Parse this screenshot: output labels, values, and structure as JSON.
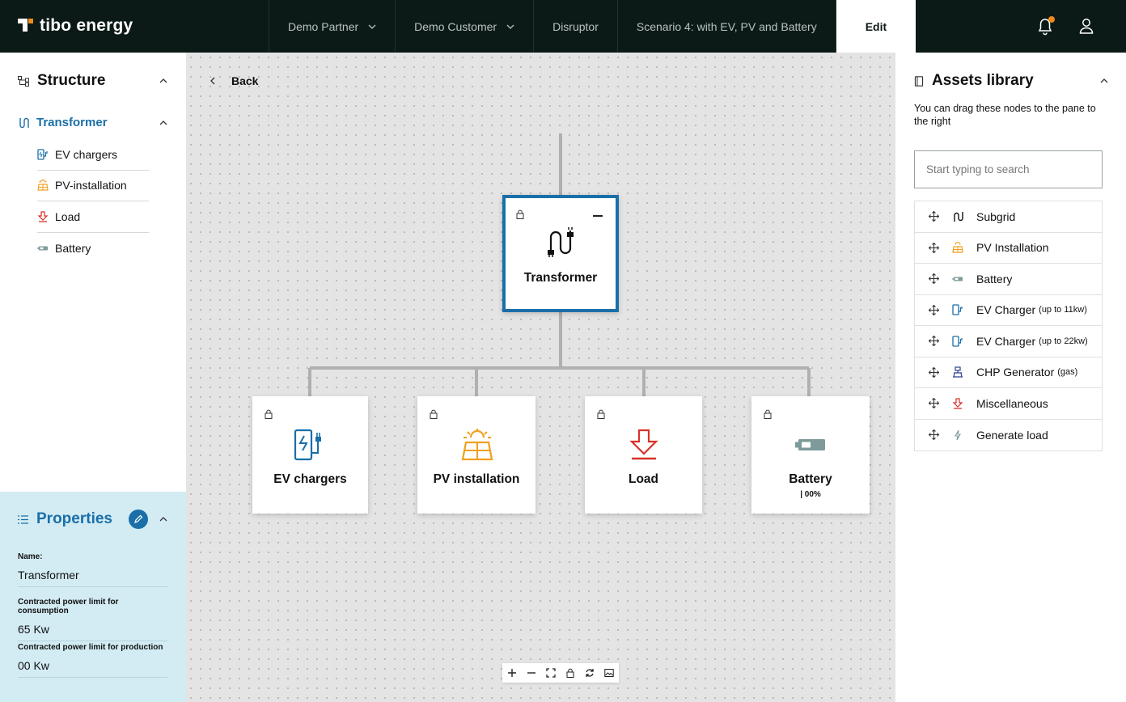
{
  "brand": {
    "name": "tibo energy",
    "accent": "#f08a1c",
    "primary": "#1a6fa8",
    "dark": "#0c1a17"
  },
  "topnav": {
    "items": [
      {
        "label": "Demo Partner",
        "has_dropdown": true
      },
      {
        "label": "Demo Customer",
        "has_dropdown": true
      },
      {
        "label": "Disruptor",
        "has_dropdown": false
      },
      {
        "label": "Scenario 4: with EV, PV and Battery",
        "has_dropdown": false
      },
      {
        "label": "Edit",
        "active": true
      }
    ],
    "icons": [
      "bell-icon",
      "user-icon"
    ]
  },
  "structure": {
    "title": "Structure",
    "root": {
      "label": "Transformer",
      "icon": "transformer-icon"
    },
    "children": [
      {
        "label": "EV chargers",
        "icon": "ev-charger-icon"
      },
      {
        "label": "PV-installation",
        "icon": "solar-panel-icon"
      },
      {
        "label": "Load",
        "icon": "load-arrow-icon"
      },
      {
        "label": "Battery",
        "icon": "battery-icon"
      }
    ]
  },
  "properties": {
    "title": "Properties",
    "fields": [
      {
        "label": "Name:",
        "value": "Transformer"
      },
      {
        "label": "Contracted power limit for consumption",
        "value": "65 Kw"
      },
      {
        "label": "Contracted power limit for production",
        "value": "00 Kw"
      }
    ]
  },
  "canvas": {
    "back_label": "Back",
    "root_node": {
      "label": "Transformer"
    },
    "child_nodes": [
      {
        "label": "EV chargers",
        "sub": ""
      },
      {
        "label": "PV installation",
        "sub": ""
      },
      {
        "label": "Load",
        "sub": ""
      },
      {
        "label": "Battery",
        "sub": "| 00%"
      }
    ],
    "zoom_controls": [
      "zoom-in-icon",
      "zoom-out-icon",
      "fit-view-icon",
      "lock-icon",
      "refresh-icon",
      "image-icon"
    ]
  },
  "assets": {
    "title": "Assets library",
    "hint": "You can drag these nodes to the pane to the right",
    "search_placeholder": "Start typing to search",
    "items": [
      {
        "label": "Subgrid",
        "suffix": ""
      },
      {
        "label": "PV Installation",
        "suffix": ""
      },
      {
        "label": "Battery",
        "suffix": ""
      },
      {
        "label": "EV Charger",
        "suffix": "(up to 11kw)"
      },
      {
        "label": "EV Charger",
        "suffix": "(up to 22kw)"
      },
      {
        "label": "CHP Generator",
        "suffix": "(gas)"
      },
      {
        "label": "Miscellaneous",
        "suffix": ""
      },
      {
        "label": "Generate load",
        "suffix": ""
      }
    ]
  }
}
